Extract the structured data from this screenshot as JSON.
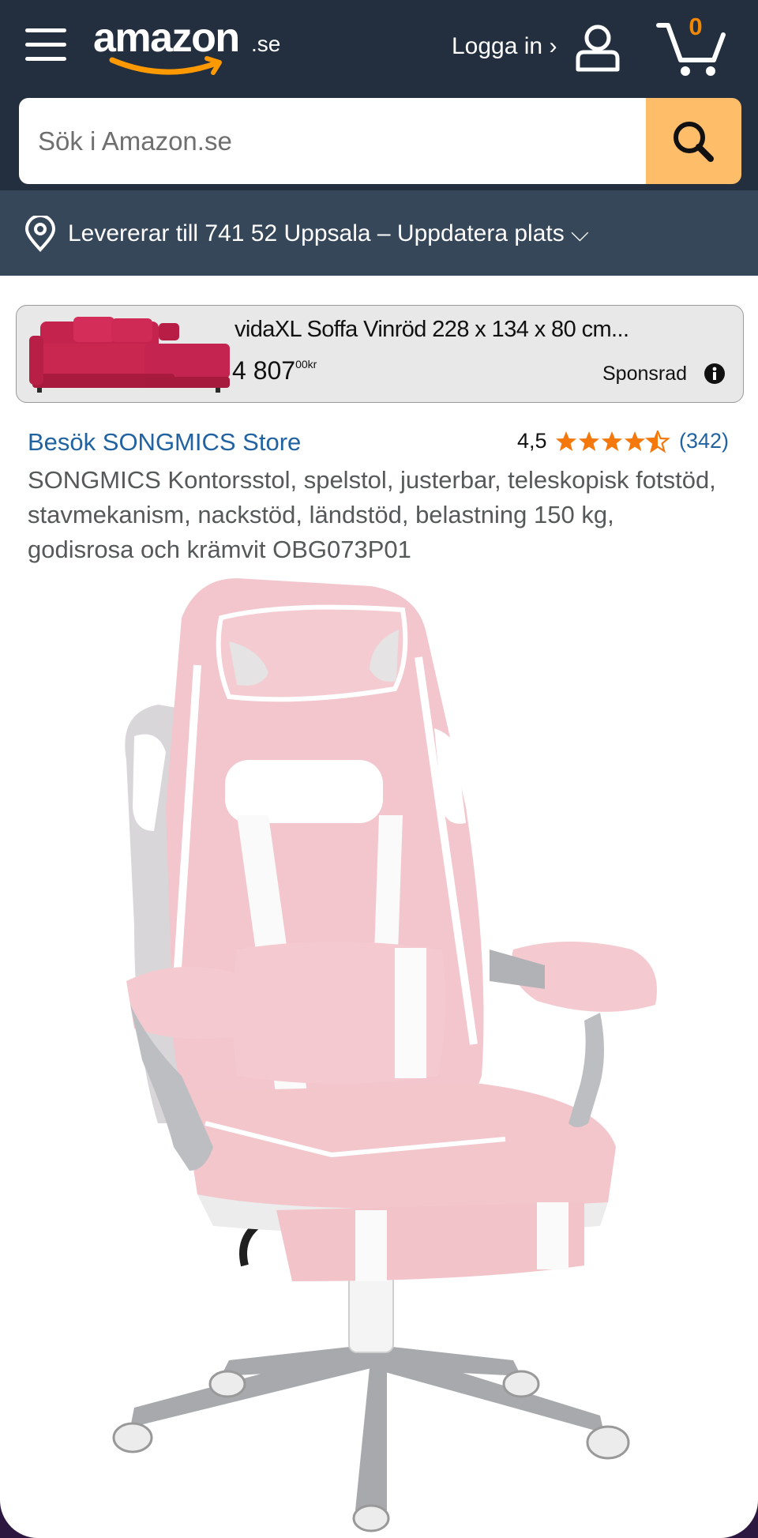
{
  "header": {
    "logo_text": "amazon",
    "logo_tld": ".se",
    "signin_label": "Logga in ›",
    "cart_count": "0"
  },
  "search": {
    "placeholder": "Sök i Amazon.se"
  },
  "location": {
    "text": "Levererar till 741 52 Uppsala – Uppdatera plats ⌵"
  },
  "sponsored_ad": {
    "title": "vidaXL Soffa Vinröd 228 x 134 x 80 cm...",
    "price_whole": "4 807",
    "price_fraction": "00",
    "currency": "kr",
    "label": "Sponsrad"
  },
  "product": {
    "store_link": "Besök SONGMICS Store",
    "rating_value": "4,5",
    "rating_stars": 4.5,
    "rating_count": "(342)",
    "title": "SONGMICS Kontorsstol, spelstol, justerbar, teleskopisk fotstöd, stavmekanism, nackstöd, ländstöd, belastning 150 kg, godisrosa och krämvit OBG073P01"
  },
  "colors": {
    "header_bg": "#232f3e",
    "location_bg": "#37475a",
    "search_button": "#febd69",
    "cart_count": "#f08804",
    "star": "#f4780c",
    "link": "#2162a1"
  }
}
